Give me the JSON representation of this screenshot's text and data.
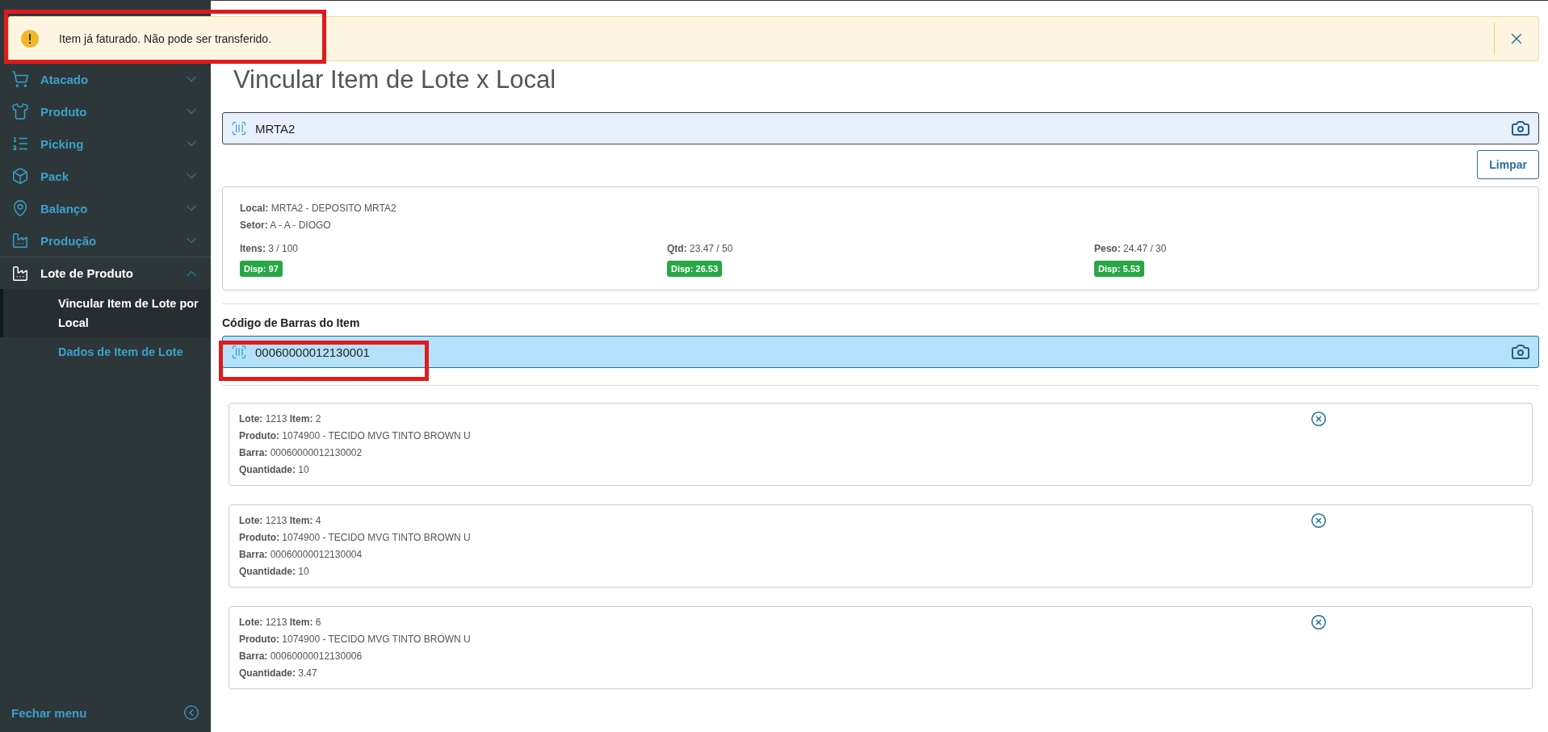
{
  "toast": {
    "message": "Item já faturado. Não pode ser transferido."
  },
  "sidebar": {
    "items": [
      {
        "label": "Atacado",
        "expanded": false
      },
      {
        "label": "Produto",
        "expanded": false
      },
      {
        "label": "Picking",
        "expanded": false
      },
      {
        "label": "Pack",
        "expanded": false
      },
      {
        "label": "Balanço",
        "expanded": false
      },
      {
        "label": "Produção",
        "expanded": false
      },
      {
        "label": "Lote de Produto",
        "expanded": true,
        "children": [
          {
            "label": "Vincular Item de Lote por Local",
            "selected": true
          },
          {
            "label": "Dados de Item de Lote",
            "selected": false
          }
        ]
      }
    ],
    "footer": "Fechar menu"
  },
  "page": {
    "title": "Vincular Item de Lote x Local"
  },
  "location_field": {
    "value": "MRTA2"
  },
  "clear_button": "Limpar",
  "location_card": {
    "lines": [
      "**Local:** MRTA2 - DEPOSITO MRTA2",
      "**Setor:** A - A - DIOGO"
    ],
    "stats": [
      {
        "text": "**Itens:** 3 / 100",
        "badge": "Disp: 97"
      },
      {
        "text": "**Qtd:** 23.47 / 50",
        "badge": "Disp: 26.53"
      },
      {
        "text": "**Peso:** 24.47 / 30",
        "badge": "Disp: 5.53"
      }
    ]
  },
  "barcode_field": {
    "label": "Código de Barras do Item",
    "value": "00060000012130001"
  },
  "items": [
    {
      "lines": [
        "**Lote:** 1213 **Item:** 2",
        "**Produto:** 1074900 - TECIDO MVG TINTO BROWN U",
        "**Barra:** 00060000012130002",
        "**Quantidade:** 10"
      ]
    },
    {
      "lines": [
        "**Lote:** 1213 **Item:** 4",
        "**Produto:** 1074900 - TECIDO MVG TINTO BROWN U",
        "**Barra:** 00060000012130004",
        "**Quantidade:** 10"
      ]
    },
    {
      "lines": [
        "**Lote:** 1213 **Item:** 6",
        "**Produto:** 1074900 - TECIDO MVG TINTO BROWN U",
        "**Barra:** 00060000012130006",
        "**Quantidade:** 3.47"
      ]
    }
  ]
}
